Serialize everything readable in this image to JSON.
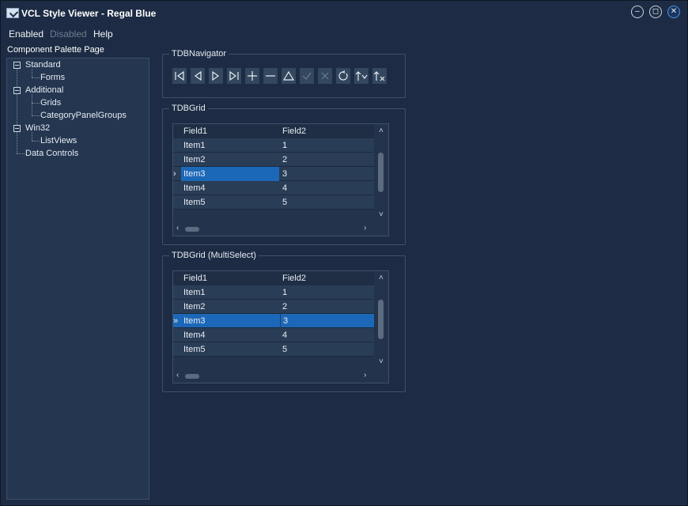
{
  "window": {
    "title": "VCL Style Viewer - Regal Blue"
  },
  "menu": [
    {
      "label": "Enabled",
      "disabled": false
    },
    {
      "label": "Disabled",
      "disabled": true
    },
    {
      "label": "Help",
      "disabled": false
    }
  ],
  "palette": {
    "label": "Component Palette Page",
    "tree": [
      {
        "label": "Standard",
        "children": [
          "Forms"
        ]
      },
      {
        "label": "Additional",
        "children": [
          "Grids",
          "CategoryPanelGroups"
        ]
      },
      {
        "label": "Win32",
        "children": [
          "ListViews"
        ]
      },
      {
        "label": "Data Controls",
        "children": []
      }
    ]
  },
  "navigator": {
    "caption": "TDBNavigator",
    "buttons": [
      "first-icon",
      "prior-icon",
      "next-icon",
      "last-icon",
      "insert-icon",
      "delete-icon",
      "edit-icon",
      "post-icon",
      "cancel-icon",
      "refresh-icon",
      "apply-updates-icon",
      "cancel-updates-icon"
    ]
  },
  "grid1": {
    "caption": "TDBGrid",
    "columns": [
      "Field1",
      "Field2"
    ],
    "rows": [
      [
        "Item1",
        "1"
      ],
      [
        "Item2",
        "2"
      ],
      [
        "Item3",
        "3"
      ],
      [
        "Item4",
        "4"
      ],
      [
        "Item5",
        "5"
      ]
    ],
    "current_row": 2
  },
  "grid2": {
    "caption": "TDBGrid (MultiSelect)",
    "columns": [
      "Field1",
      "Field2"
    ],
    "rows": [
      [
        "Item1",
        "1"
      ],
      [
        "Item2",
        "2"
      ],
      [
        "Item3",
        "3"
      ],
      [
        "Item4",
        "4"
      ],
      [
        "Item5",
        "5"
      ]
    ],
    "current_row": 2
  },
  "colors": {
    "background": "#1d2c44",
    "selection": "#1c68b8",
    "border": "#3e5168"
  }
}
